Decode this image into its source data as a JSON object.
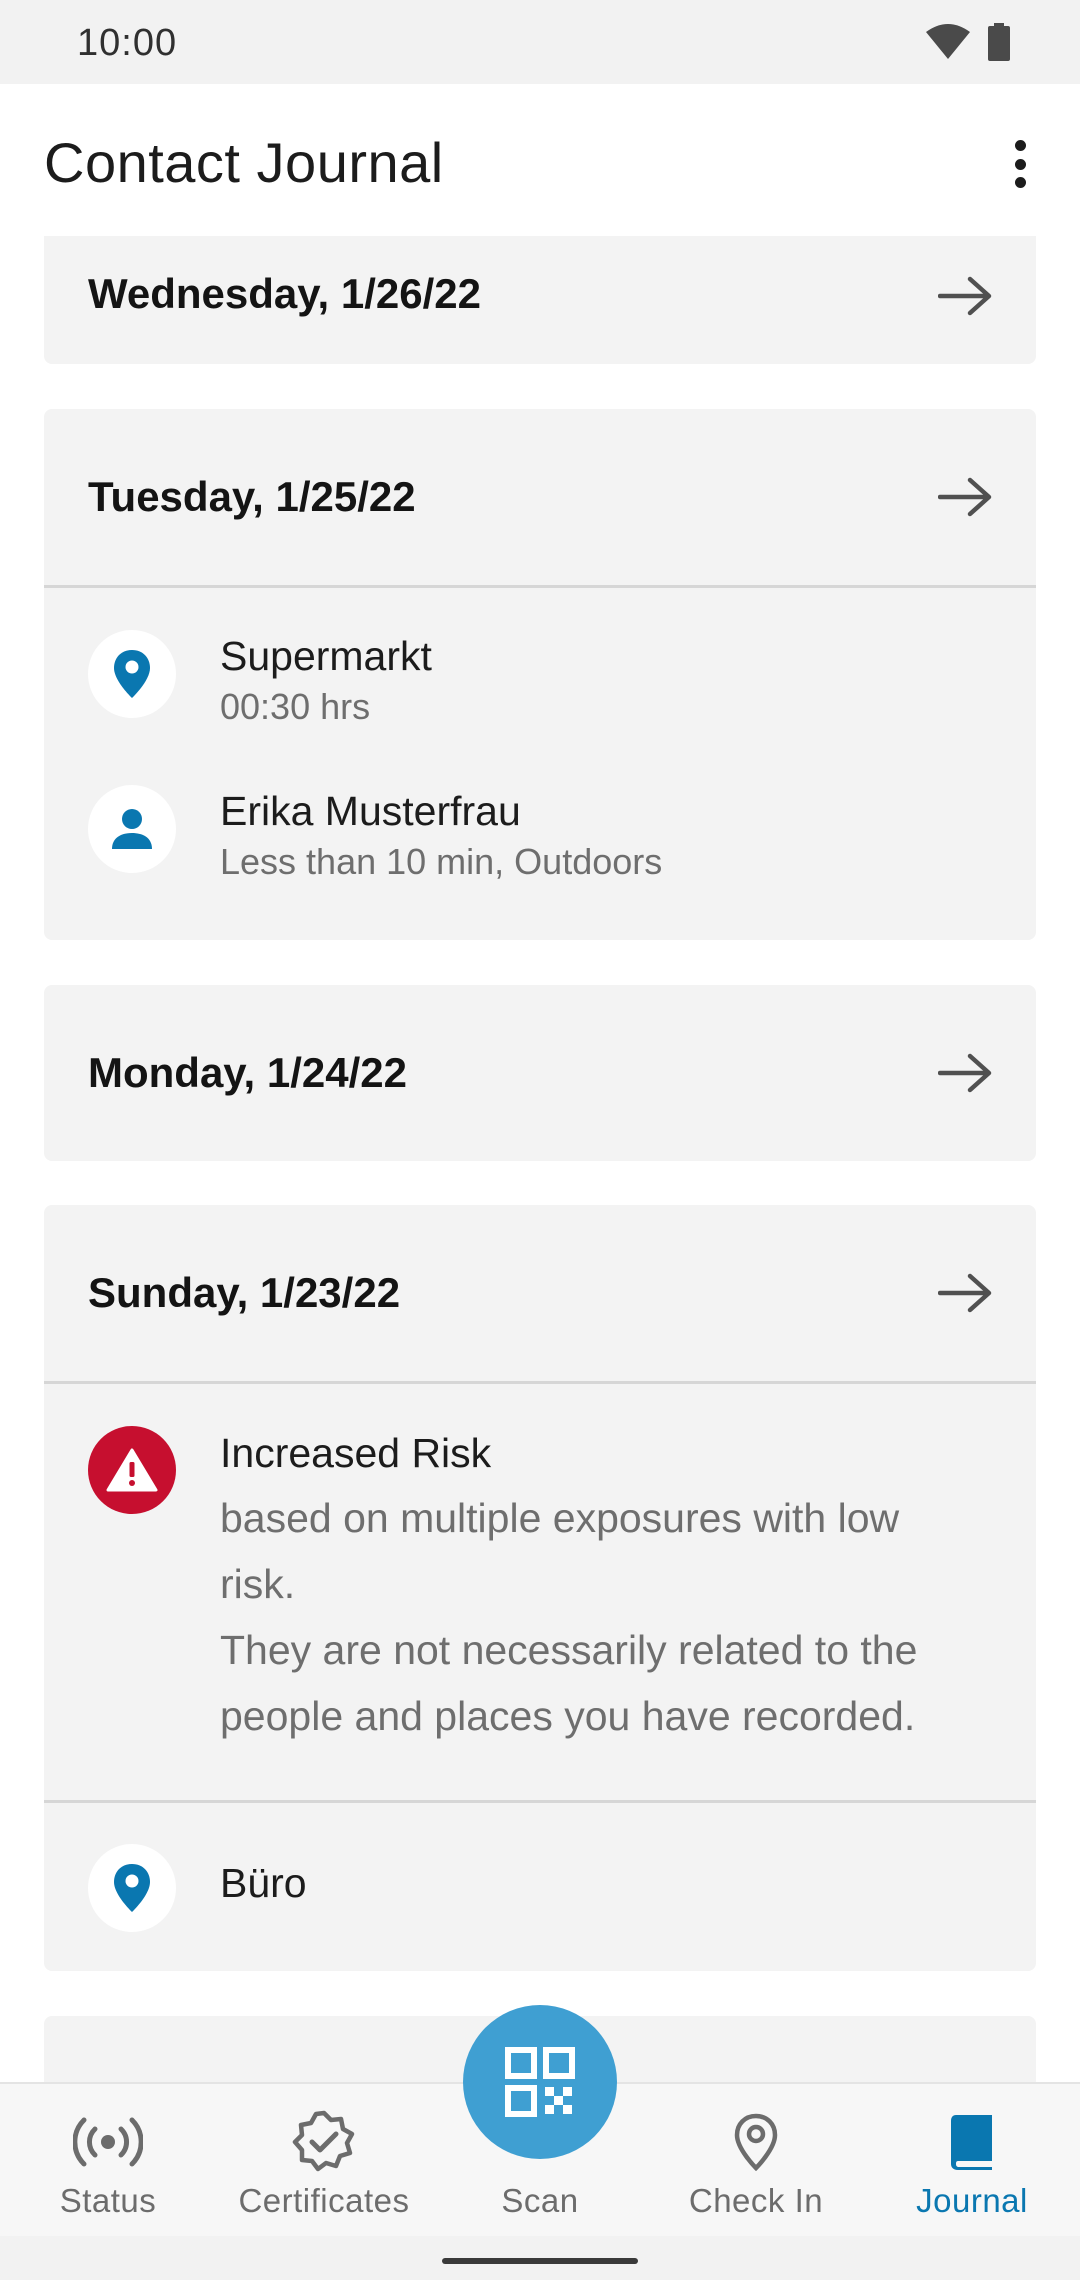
{
  "status_bar": {
    "time": "10:00"
  },
  "app_bar": {
    "title": "Contact Journal"
  },
  "days": [
    {
      "label": "Wednesday, 1/26/22"
    },
    {
      "label": "Tuesday, 1/25/22",
      "entries": [
        {
          "icon": "location-pin-icon",
          "title": "Supermarkt",
          "subtitle": "00:30 hrs"
        },
        {
          "icon": "person-icon",
          "title": "Erika Musterfrau",
          "subtitle": "Less than 10 min, Outdoors"
        }
      ]
    },
    {
      "label": "Monday, 1/24/22"
    },
    {
      "label": "Sunday, 1/23/22",
      "risk": {
        "icon": "warning-icon",
        "title": "Increased Risk",
        "line1": "based on multiple exposures with low risk.",
        "line2": "They are not necessarily related to the people and places you have recorded."
      },
      "entries": [
        {
          "icon": "location-pin-icon",
          "title": "Büro"
        }
      ]
    }
  ],
  "bottom_nav": {
    "items": [
      {
        "label": "Status",
        "icon": "broadcast-icon",
        "active": false
      },
      {
        "label": "Certificates",
        "icon": "certificate-badge-icon",
        "active": false
      },
      {
        "label": "Scan",
        "icon": "qr-code-icon",
        "active": false
      },
      {
        "label": "Check In",
        "icon": "location-pin-icon",
        "active": false
      },
      {
        "label": "Journal",
        "icon": "book-icon",
        "active": true
      }
    ]
  },
  "colors": {
    "accent": "#0a77b0",
    "fab": "#3f9fd2",
    "risk": "#c60f2f",
    "card": "#f3f3f3"
  }
}
